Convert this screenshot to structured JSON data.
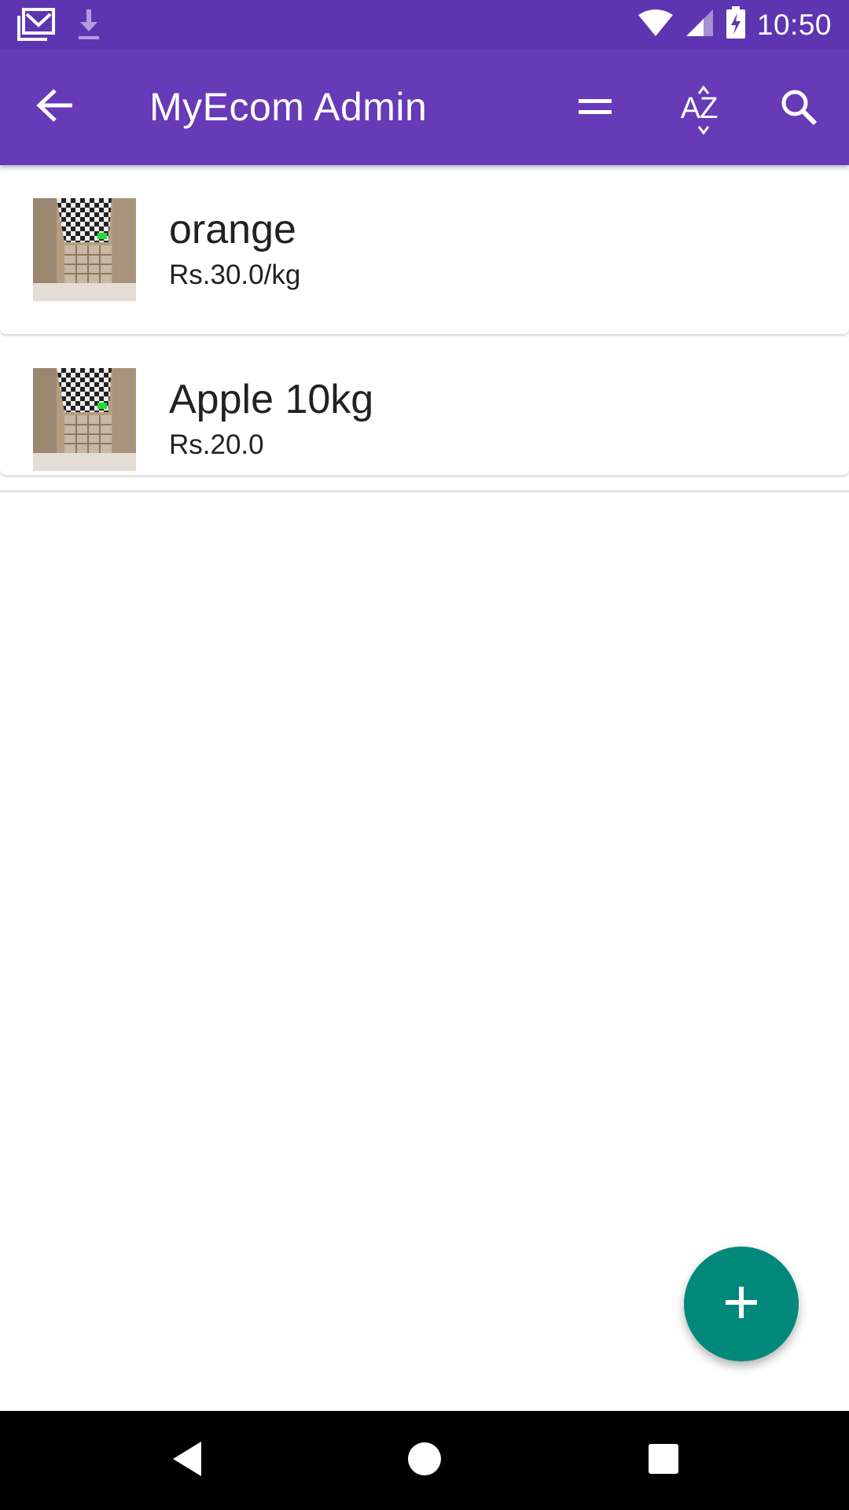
{
  "status_bar": {
    "time": "10:50",
    "icons": [
      "gmail-icon",
      "download-icon",
      "wifi-icon",
      "signal-icon",
      "battery-charging-icon"
    ]
  },
  "app_bar": {
    "title": "MyEcom Admin",
    "back_icon": "arrow-back-icon",
    "actions": [
      "menu-icon",
      "sort-az-icon",
      "search-icon"
    ],
    "sort_label": "AZ"
  },
  "items": [
    {
      "name": "orange",
      "price": "Rs.30.0/kg",
      "image": "product-thumbnail"
    },
    {
      "name": "Apple 10kg",
      "price": "Rs.20.0",
      "image": "product-thumbnail"
    }
  ],
  "fab": {
    "icon": "plus-icon"
  },
  "nav_bar": {
    "icons": [
      "nav-back-icon",
      "nav-home-icon",
      "nav-recents-icon"
    ]
  },
  "colors": {
    "status_bar": "#5e35b1",
    "app_bar": "#673ab7",
    "fab": "#00897b",
    "text_primary": "#212121"
  }
}
